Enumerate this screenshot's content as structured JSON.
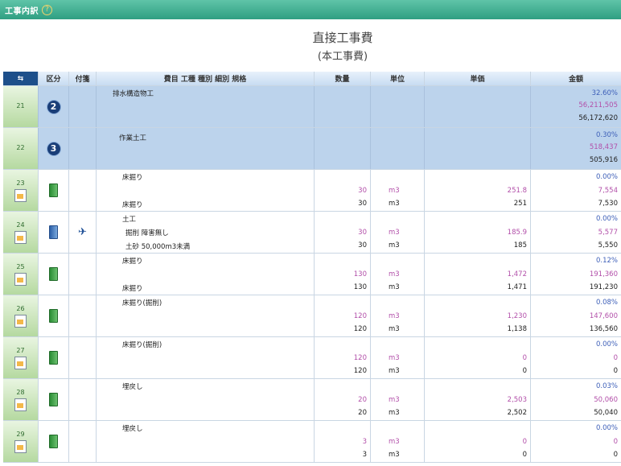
{
  "topbar": {
    "title": "工事内訳"
  },
  "page_title": {
    "line1": "直接工事費",
    "line2": "(本工事費)"
  },
  "columns": {
    "kubun": "区分",
    "tsuke": "付箋",
    "name": "費目 工種 種別 細別 規格",
    "qty": "数量",
    "unit": "単位",
    "price": "単価",
    "amount": "金額"
  },
  "rows": [
    {
      "no": "21",
      "badge": "2",
      "name_top": "排水構造物工",
      "amt_pct": "32.60%",
      "amt_p": "56,211,505",
      "amt_d": "56,172,620"
    },
    {
      "no": "22",
      "badge": "3",
      "name_top": "作業土工",
      "amt_pct": "0.30%",
      "amt_p": "518,437",
      "amt_d": "505,916"
    },
    {
      "no": "23",
      "name_top": "床掘り",
      "name_bot": "床掘り",
      "qty_p": "30",
      "qty_d": "30",
      "unit_p": "m3",
      "unit_d": "m3",
      "price_p": "251.8",
      "price_d": "251",
      "amt_pct": "0.00%",
      "amt_p": "7,554",
      "amt_d": "7,530"
    },
    {
      "no": "24",
      "name_top": "土工",
      "name_mid": "掘削 障害無し",
      "name_bot": "土砂 50,000m3未満",
      "qty_p": "30",
      "qty_d": "30",
      "unit_p": "m3",
      "unit_d": "m3",
      "price_p": "185.9",
      "price_d": "185",
      "amt_pct": "0.00%",
      "amt_p": "5,577",
      "amt_d": "5,550"
    },
    {
      "no": "25",
      "name_top": "床掘り",
      "name_bot": "床掘り",
      "qty_p": "130",
      "qty_d": "130",
      "unit_p": "m3",
      "unit_d": "m3",
      "price_p": "1,472",
      "price_d": "1,471",
      "amt_pct": "0.12%",
      "amt_p": "191,360",
      "amt_d": "191,230"
    },
    {
      "no": "26",
      "name_top": "床掘り(掘削)",
      "qty_p": "120",
      "qty_d": "120",
      "unit_p": "m3",
      "unit_d": "m3",
      "price_p": "1,230",
      "price_d": "1,138",
      "amt_pct": "0.08%",
      "amt_p": "147,600",
      "amt_d": "136,560"
    },
    {
      "no": "27",
      "name_top": "床掘り(掘削)",
      "qty_p": "120",
      "qty_d": "120",
      "unit_p": "m3",
      "unit_d": "m3",
      "price_p": "0",
      "price_d": "0",
      "amt_pct": "0.00%",
      "amt_p": "0",
      "amt_d": "0"
    },
    {
      "no": "28",
      "name_top": "埋戻し",
      "qty_p": "20",
      "qty_d": "20",
      "unit_p": "m3",
      "unit_d": "m3",
      "price_p": "2,503",
      "price_d": "2,502",
      "amt_pct": "0.03%",
      "amt_p": "50,060",
      "amt_d": "50,040"
    },
    {
      "no": "29",
      "name_top": "埋戻し",
      "qty_p": "3",
      "qty_d": "3",
      "unit_p": "m3",
      "unit_d": "m3",
      "price_p": "0",
      "price_d": "0",
      "amt_pct": "0.00%",
      "amt_p": "0",
      "amt_d": "0"
    }
  ]
}
